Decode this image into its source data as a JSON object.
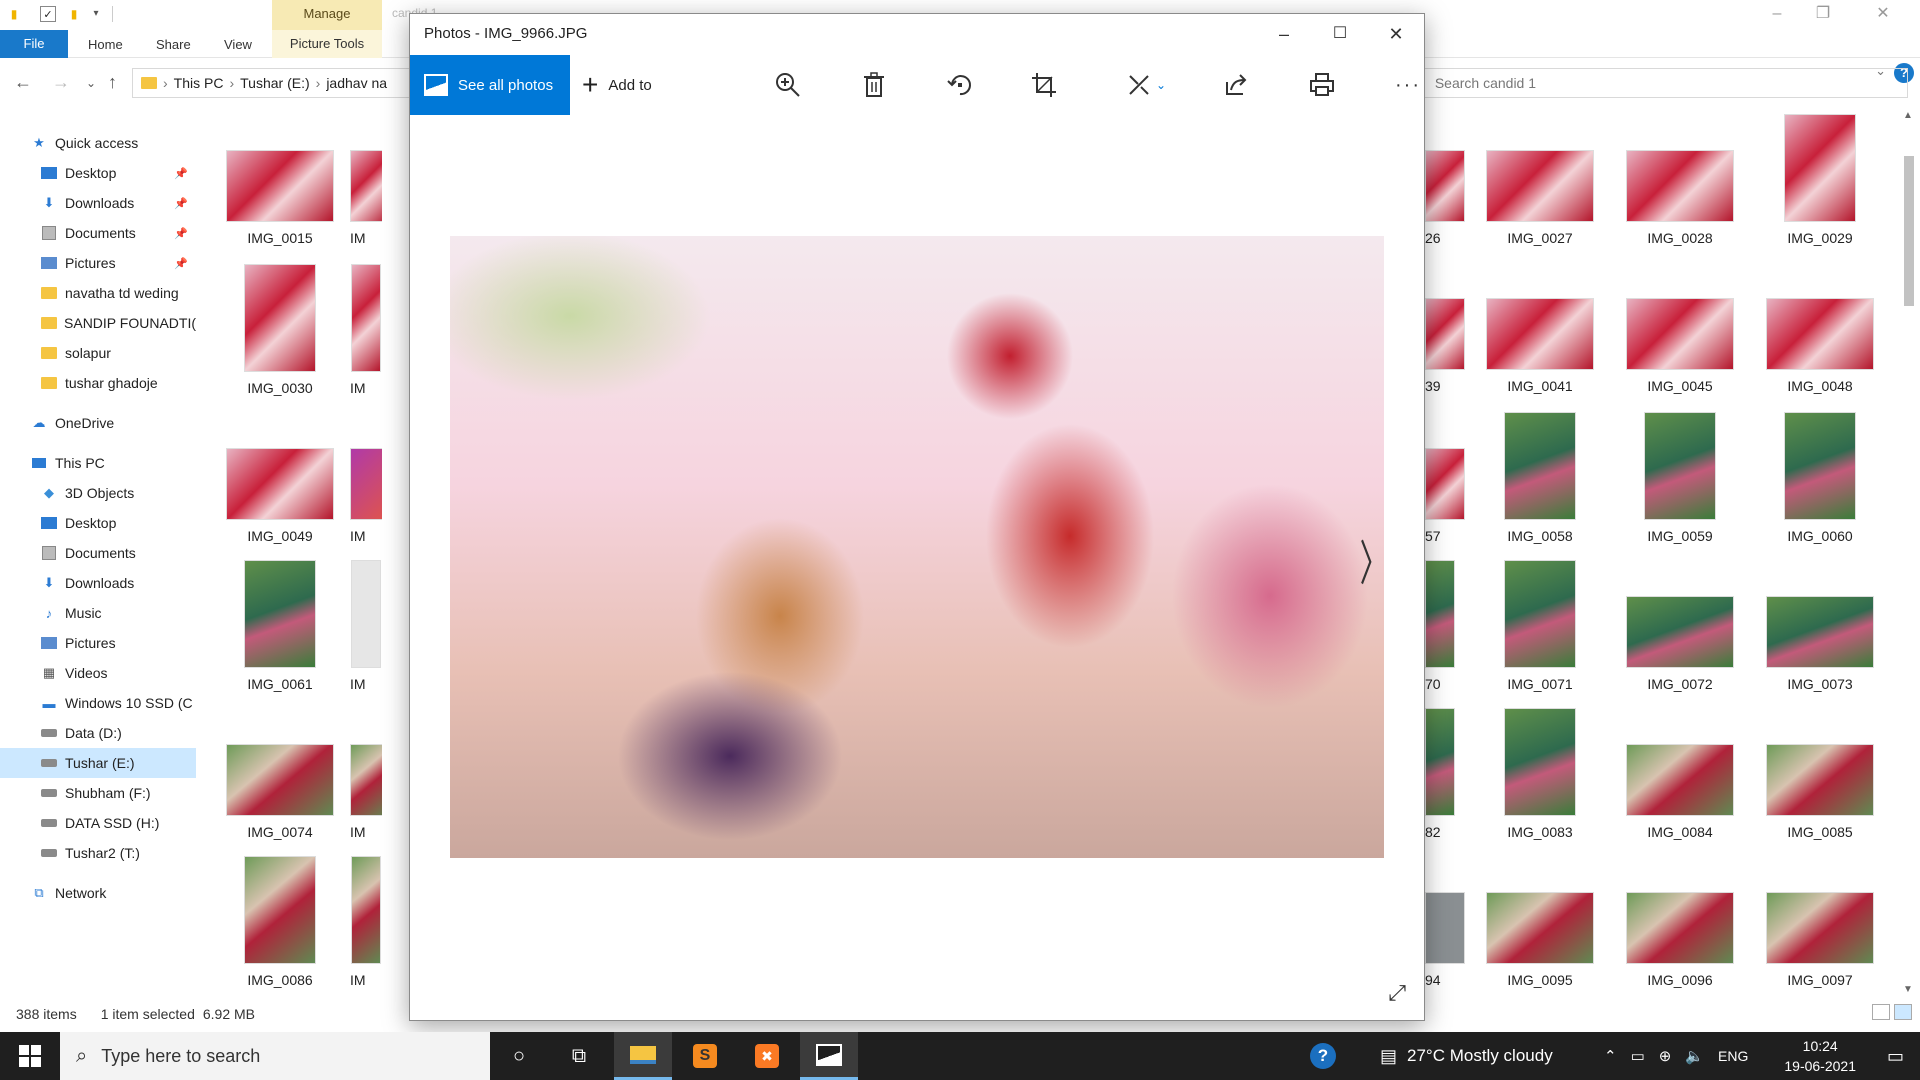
{
  "explorer": {
    "title": "candid 1",
    "ribbon": {
      "file": "File",
      "home": "Home",
      "share": "Share",
      "view": "View",
      "manage": "Manage",
      "picture_tools": "Picture Tools"
    },
    "breadcrumb": [
      "This PC",
      "Tushar (E:)",
      "jadhav na"
    ],
    "search_placeholder": "Search candid 1",
    "nav": {
      "quick_access": "Quick access",
      "quick_items": [
        "Desktop",
        "Downloads",
        "Documents",
        "Pictures",
        "navatha td weding",
        "SANDIP FOUNADTI(",
        "solapur",
        "tushar ghadoje"
      ],
      "onedrive": "OneDrive",
      "this_pc": "This PC",
      "pc_items": [
        "3D Objects",
        "Desktop",
        "Documents",
        "Downloads",
        "Music",
        "Pictures",
        "Videos",
        "Windows 10 SSD (C",
        "Data (D:)",
        "Tushar (E:)",
        "Shubham (F:)",
        "DATA SSD (H:)",
        "Tushar2 (T:)"
      ],
      "network": "Network"
    },
    "grid_left": [
      [
        "IMG_0015",
        "IM"
      ],
      [
        "IMG_0030",
        "IM"
      ],
      [
        "IMG_0049",
        "IM"
      ],
      [
        "IMG_0061",
        "IM"
      ],
      [
        "IMG_0074",
        "IM"
      ],
      [
        "IMG_0086",
        "IM"
      ]
    ],
    "grid_right": [
      [
        "26",
        "IMG_0027",
        "IMG_0028",
        "IMG_0029"
      ],
      [
        "39",
        "IMG_0041",
        "IMG_0045",
        "IMG_0048"
      ],
      [
        "57",
        "IMG_0058",
        "IMG_0059",
        "IMG_0060"
      ],
      [
        "70",
        "IMG_0071",
        "IMG_0072",
        "IMG_0073"
      ],
      [
        "82",
        "IMG_0083",
        "IMG_0084",
        "IMG_0085"
      ],
      [
        "94",
        "IMG_0095",
        "IMG_0096",
        "IMG_0097"
      ]
    ],
    "status": {
      "items": "388 items",
      "selected": "1 item selected",
      "size": "6.92 MB"
    }
  },
  "photos": {
    "title": "Photos - IMG_9966.JPG",
    "see_all": "See all photos",
    "add_to": "Add to",
    "tools": [
      "zoom-icon",
      "delete-icon",
      "rotate-icon",
      "crop-icon",
      "edit-icon",
      "share-icon",
      "print-icon",
      "more-icon"
    ]
  },
  "taskbar": {
    "search_placeholder": "Type here to search",
    "weather": "27°C  Mostly cloudy",
    "lang": "ENG",
    "time": "10:24",
    "date": "19-06-2021"
  }
}
